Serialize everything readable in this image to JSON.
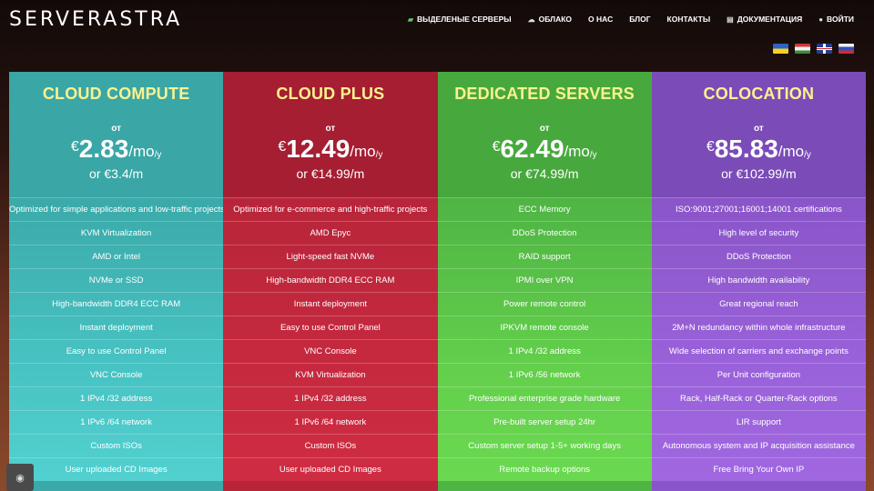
{
  "brand": {
    "logo": "SERVERASTRA"
  },
  "nav": {
    "items": [
      {
        "label": "ВЫДЕЛЕНЫЕ СЕРВЕРЫ",
        "icon": "server-icon"
      },
      {
        "label": "ОБЛАКО",
        "icon": "cloud-icon"
      },
      {
        "label": "О НАС",
        "icon": ""
      },
      {
        "label": "БЛОГ",
        "icon": ""
      },
      {
        "label": "КОНТАКТЫ",
        "icon": ""
      },
      {
        "label": "ДОКУМЕНТАЦИЯ",
        "icon": "book-icon"
      },
      {
        "label": "ВОЙТИ",
        "icon": "user-icon"
      }
    ],
    "icon_glyphs": {
      "server": "▰",
      "cloud": "☁",
      "book": "▤",
      "user": "●"
    }
  },
  "languages": [
    "ukrainian-flag-icon",
    "hungarian-flag-icon",
    "uk-flag-icon",
    "russian-flag-icon"
  ],
  "colors": {
    "cloud_compute": "#3ba9a9",
    "cloud_plus": "#b8253a",
    "dedicated_servers": "#4fb444",
    "colocation": "#8a55c8",
    "title_accent": "#fbf28e"
  },
  "plans": [
    {
      "title": "CLOUD COMPUTE",
      "from": "от",
      "currency": "€",
      "price": "2.83",
      "unit": "/mo",
      "per": "/y",
      "alt": "or €3.4/m",
      "features": [
        "Optimized for simple applications and low-traffic projects",
        "KVM Virtualization",
        "AMD or Intel",
        "NVMe or SSD",
        "High-bandwidth DDR4 ECC RAM",
        "Instant deployment",
        "Easy to use Control Panel",
        "VNC Console",
        "1 IPv4 /32 address",
        "1 IPv6 /64 network",
        "Custom ISOs",
        "User uploaded CD Images"
      ]
    },
    {
      "title": "CLOUD PLUS",
      "from": "от",
      "currency": "€",
      "price": "12.49",
      "unit": "/mo",
      "per": "/y",
      "alt": "or €14.99/m",
      "features": [
        "Optimized for e-commerce and high-traffic projects",
        "AMD Epyc",
        "Light-speed fast NVMe",
        "High-bandwidth DDR4 ECC RAM",
        "Instant deployment",
        "Easy to use Control Panel",
        "VNC Console",
        "KVM Virtualization",
        "1 IPv4 /32 address",
        "1 IPv6 /64 network",
        "Custom ISOs",
        "User uploaded CD Images"
      ]
    },
    {
      "title": "DEDICATED SERVERS",
      "from": "от",
      "currency": "€",
      "price": "62.49",
      "unit": "/mo",
      "per": "/y",
      "alt": "or €74.99/m",
      "features": [
        "ECC Memory",
        "DDoS Protection",
        "RAID support",
        "IPMI over VPN",
        "Power remote control",
        "IPKVM remote console",
        "1 IPv4 /32 address",
        "1 IPv6 /56 network",
        "Professional enterprise grade hardware",
        "Pre-built server setup 24hr",
        "Custom server setup 1-5+ working days",
        "Remote backup options"
      ]
    },
    {
      "title": "COLOCATION",
      "from": "от",
      "currency": "€",
      "price": "85.83",
      "unit": "/mo",
      "per": "/y",
      "alt": "or €102.99/m",
      "features": [
        "ISO:9001;27001;16001;14001 certifications",
        "High level of security",
        "DDoS Protection",
        "High bandwidth availability",
        "Great regional reach",
        "2M+N redundancy within whole infrastructure",
        "Wide selection of carriers and exchange points",
        "Per Unit configuration",
        "Rack, Half-Rack or Quarter-Rack options",
        "LIR support",
        "Autonomous system and IP acquisition assistance",
        "Free Bring Your Own IP"
      ]
    }
  ],
  "accessibility": {
    "icon": "eye-icon",
    "glyph": "◉"
  }
}
